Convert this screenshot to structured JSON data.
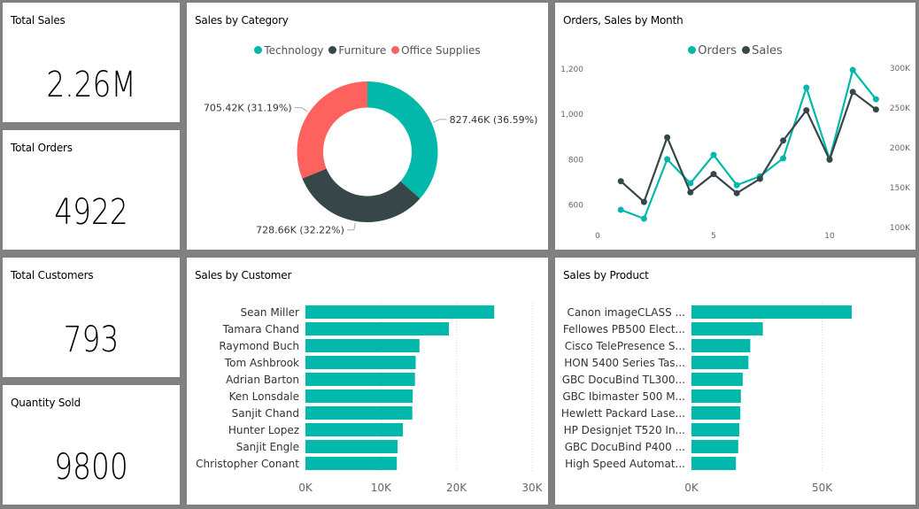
{
  "colors": {
    "background": "#808080",
    "teal": "#01B8AA",
    "dark": "#374649",
    "red": "#FD625E"
  },
  "kpis": [
    {
      "title": "Total Sales",
      "value": "2.26M"
    },
    {
      "title": "Total Orders",
      "value": "4922"
    },
    {
      "title": "Total Customers",
      "value": "793"
    },
    {
      "title": "Quantity Sold",
      "value": "9800"
    }
  ],
  "category_card": {
    "title": "Sales by Category"
  },
  "month_card": {
    "title": "Orders, Sales by Month"
  },
  "customer_card": {
    "title": "Sales by Customer"
  },
  "product_card": {
    "title": "Sales by Product"
  },
  "chart_data": [
    {
      "id": "sales-by-category",
      "type": "pie",
      "donut": true,
      "title": "Sales by Category",
      "legend_position": "top-center",
      "categories": [
        "Technology",
        "Furniture",
        "Office Supplies"
      ],
      "values": [
        827.46,
        728.66,
        705.42
      ],
      "units": "K",
      "percentages": [
        36.59,
        32.22,
        31.19
      ],
      "data_labels": [
        "827.46K (36.59%)",
        "728.66K (32.22%)",
        "705.42K (31.19%)"
      ],
      "colors": [
        "#01B8AA",
        "#374649",
        "#FD625E"
      ]
    },
    {
      "id": "orders-sales-by-month",
      "type": "line",
      "title": "Orders, Sales by Month",
      "legend_position": "top-center",
      "x": [
        1,
        2,
        3,
        4,
        5,
        6,
        7,
        8,
        9,
        10,
        11,
        12
      ],
      "xticks": [
        "0",
        "5",
        "10"
      ],
      "xtick_values": [
        0,
        5,
        10
      ],
      "xlim": [
        0,
        12.5
      ],
      "series": [
        {
          "name": "Orders",
          "axis": "left",
          "color": "#01B8AA",
          "values": [
            575,
            536,
            798,
            692,
            817,
            684,
            723,
            802,
            1114,
            798,
            1192,
            1063
          ]
        },
        {
          "name": "Sales",
          "axis": "right",
          "color": "#374649",
          "values": [
            157,
            131,
            212,
            143,
            166,
            142,
            160,
            208,
            246,
            184,
            269,
            247
          ]
        }
      ],
      "y_left": {
        "ticks": [
          "600",
          "800",
          "1,000",
          "1,200"
        ],
        "tick_values": [
          600,
          800,
          1000,
          1200
        ],
        "ylim": [
          500,
          1200
        ]
      },
      "y_right": {
        "ticks": [
          "100K",
          "150K",
          "200K",
          "250K",
          "300K"
        ],
        "tick_values": [
          100,
          150,
          200,
          250,
          300
        ],
        "ylim": [
          100,
          300
        ],
        "units": "K"
      },
      "grid": false
    },
    {
      "id": "sales-by-customer",
      "type": "bar",
      "orientation": "horizontal",
      "title": "Sales by Customer",
      "categories": [
        "Sean Miller",
        "Tamara Chand",
        "Raymond Buch",
        "Tom Ashbrook",
        "Adrian Barton",
        "Ken Lonsdale",
        "Sanjit Chand",
        "Hunter Lopez",
        "Sanjit Engle",
        "Christopher Conant"
      ],
      "values": [
        25.0,
        19.0,
        15.1,
        14.6,
        14.5,
        14.2,
        14.15,
        12.9,
        12.2,
        12.1
      ],
      "units": "K",
      "xticks": [
        "0K",
        "10K",
        "20K",
        "30K"
      ],
      "xtick_values": [
        0,
        10,
        20,
        30
      ],
      "xlim": [
        0,
        30
      ],
      "grid": true,
      "color": "#01B8AA"
    },
    {
      "id": "sales-by-product",
      "type": "bar",
      "orientation": "horizontal",
      "title": "Sales by Product",
      "categories": [
        "Canon imageCLASS ...",
        "Fellowes PB500 Elect...",
        "Cisco TelePresence S...",
        "HON 5400 Series Tas...",
        "GBC DocuBind TL300...",
        "GBC Ibimaster 500 M...",
        "Hewlett Packard Lase...",
        "HP Designjet T520 In...",
        "GBC DocuBind P400 ...",
        "High Speed Automat..."
      ],
      "values": [
        61.3,
        27.3,
        22.5,
        21.8,
        19.6,
        18.9,
        18.7,
        18.3,
        17.9,
        17.0
      ],
      "units": "K",
      "xticks": [
        "0K",
        "50K"
      ],
      "xtick_values": [
        0,
        50
      ],
      "xlim": [
        0,
        86
      ],
      "grid": true,
      "color": "#01B8AA"
    }
  ]
}
